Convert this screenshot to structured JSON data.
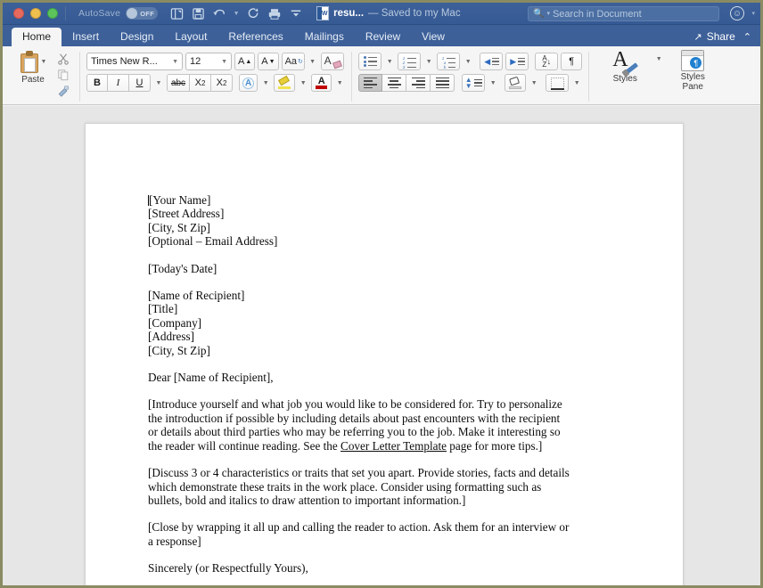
{
  "titlebar": {
    "autosave_label": "AutoSave",
    "autosave_state": "OFF",
    "doc_name": "resu...",
    "saved_status": "— Saved to my Mac",
    "search_placeholder": "Search in Document",
    "icons": {
      "sidebar": "sidebar-icon",
      "save": "save-icon",
      "undo": "undo-icon",
      "redo": "redo-icon",
      "print": "print-icon",
      "customize": "customize-icon",
      "search": "search-icon",
      "smiley": "smiley-icon"
    }
  },
  "ribbon_tabs": {
    "items": [
      {
        "label": "Home",
        "active": true
      },
      {
        "label": "Insert",
        "active": false
      },
      {
        "label": "Design",
        "active": false
      },
      {
        "label": "Layout",
        "active": false
      },
      {
        "label": "References",
        "active": false
      },
      {
        "label": "Mailings",
        "active": false
      },
      {
        "label": "Review",
        "active": false
      },
      {
        "label": "View",
        "active": false
      }
    ],
    "share_label": "Share"
  },
  "ribbon": {
    "clipboard": {
      "paste_label": "Paste",
      "cut_label": "✂",
      "copy_label": "⎘",
      "format_painter_label": "🖌"
    },
    "font": {
      "font_family_value": "Times New R...",
      "font_size_value": "12",
      "grow_font": "A",
      "shrink_font": "A",
      "change_case": "Aa",
      "clear_formatting": "A",
      "bold": "B",
      "italic": "I",
      "underline": "U",
      "strikethrough": "abc",
      "subscript": "X",
      "subscript_n": "2",
      "superscript": "X",
      "superscript_n": "2",
      "text_effects": "A",
      "highlight": "highlight-icon",
      "font_color": "A"
    },
    "paragraph": {
      "bullets": "bullets-icon",
      "numbering": "numbering-icon",
      "multilevel": "multilevel-list-icon",
      "decrease_indent": "decrease-indent-icon",
      "increase_indent": "increase-indent-icon",
      "sort": "sort-icon",
      "sort_a": "A",
      "sort_z": "Z",
      "show_marks": "¶",
      "align_left": "align-left-icon",
      "align_center": "align-center-icon",
      "align_right": "align-right-icon",
      "justify": "justify-icon",
      "line_spacing": "line-spacing-icon",
      "shading": "shading-icon",
      "borders": "borders-icon"
    },
    "styles": {
      "styles_label": "Styles",
      "styles_pane_label_1": "Styles",
      "styles_pane_label_2": "Pane",
      "pane_mark": "¶"
    }
  },
  "document": {
    "sender_block": [
      "[Your Name]",
      "[Street Address]",
      "[City, St Zip]",
      "[Optional – Email Address]"
    ],
    "date_line": "[Today's Date]",
    "recipient_block": [
      "[Name of Recipient]",
      "[Title]",
      "[Company]",
      "[Address]",
      "[City, St Zip]"
    ],
    "salutation": "Dear [Name of Recipient],",
    "paragraph_1_before_link": "[Introduce yourself and what job you would like to be considered for.  Try to personalize the introduction if possible by including details about past encounters with the recipient or details about third parties who may be referring you to the job.  Make it interesting so the reader will continue reading. See the ",
    "paragraph_1_link": "Cover Letter Template",
    "paragraph_1_after_link": " page for more tips.]",
    "paragraph_2": "[Discuss 3 or 4 characteristics or traits that set you apart.  Provide stories, facts and details which demonstrate these traits in the work place. Consider using formatting such as bullets, bold and italics to draw attention to important information.]",
    "paragraph_3": "[Close by wrapping it all up and calling the reader to action.  Ask them for an interview or a response]",
    "closing": "Sincerely (or Respectfully Yours),"
  },
  "colors": {
    "titlebar": "#3d6099",
    "ribbon_bg": "#f5f5f5",
    "doc_bg": "#e6e6e6",
    "page": "#ffffff",
    "accent_blue": "#2e6bbf",
    "window_border": "#8a8b63"
  }
}
